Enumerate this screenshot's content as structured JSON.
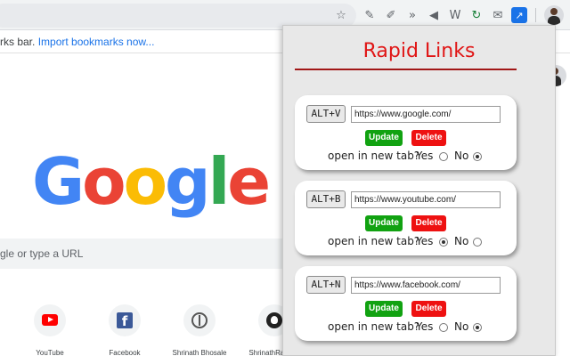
{
  "browser": {
    "bookmarks_bar": {
      "text": "rks bar. ",
      "link": "Import bookmarks now..."
    },
    "toolbar_icons": [
      "star-icon",
      "eyedropper-icon",
      "pen-icon",
      "arrows-icon",
      "speaker-icon",
      "tool-icon",
      "refresh-icon",
      "mail-icon",
      "rapid-links-icon"
    ]
  },
  "ntp": {
    "logo": {
      "letters": [
        {
          "char": "G",
          "color": "#4285f4"
        },
        {
          "char": "o",
          "color": "#ea4335"
        },
        {
          "char": "o",
          "color": "#fbbc05"
        },
        {
          "char": "g",
          "color": "#4285f4"
        },
        {
          "char": "l",
          "color": "#34a853"
        },
        {
          "char": "e",
          "color": "#ea4335"
        }
      ]
    },
    "search_placeholder": "gle or type a URL",
    "shortcuts": [
      {
        "label": "YouTube",
        "icon": "youtube-icon"
      },
      {
        "label": "Facebook",
        "icon": "facebook-icon"
      },
      {
        "label": "Shrinath Bhosale",
        "icon": "brain-icon"
      },
      {
        "label": "ShrinathRaje I...",
        "icon": "github-icon"
      }
    ]
  },
  "popup": {
    "title": "Rapid Links",
    "accent": "#e01616",
    "update_label": "Update",
    "delete_label": "Delete",
    "question": "open in new tab?",
    "yes_label": "Yes",
    "no_label": "No",
    "links": [
      {
        "key": "ALT+V",
        "url": "https://www.google.com/",
        "new_tab": "no"
      },
      {
        "key": "ALT+B",
        "url": "https://www.youtube.com/",
        "new_tab": "yes"
      },
      {
        "key": "ALT+N",
        "url": "https://www.facebook.com/",
        "new_tab": "no"
      }
    ]
  }
}
